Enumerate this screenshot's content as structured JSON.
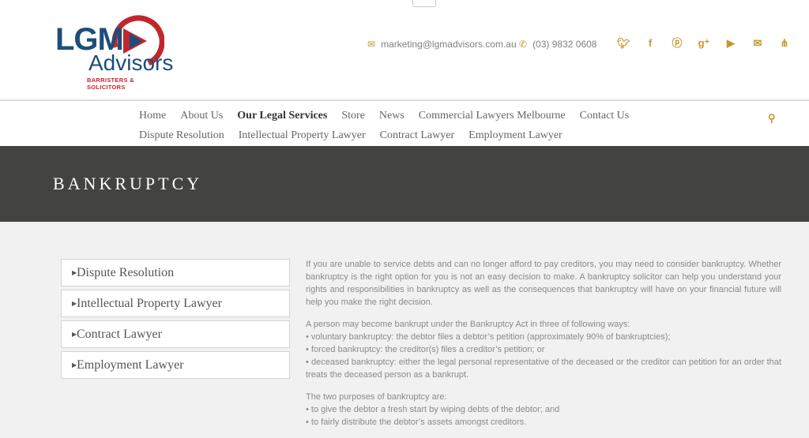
{
  "logo": {
    "line1": "LGM",
    "line2": "Advisors",
    "tagline": "BARRISTERS & SOLICITORS"
  },
  "contact": {
    "email": "marketing@lgmadvisors.com.au",
    "phone": "(03) 9832 0608",
    "email_icon": "envelope-icon",
    "phone_icon": "phone-icon"
  },
  "social": [
    "twitter-icon",
    "facebook-icon",
    "pinterest-icon",
    "google-plus-icon",
    "youtube-icon",
    "mail-icon",
    "sitemap-icon"
  ],
  "nav": {
    "row1": [
      "Home",
      "About Us",
      "Our Legal Services",
      "Store",
      "News",
      "Commercial Lawyers Melbourne",
      "Contact Us"
    ],
    "row2": [
      "Dispute Resolution",
      "Intellectual Property Lawyer",
      "Contract Lawyer",
      "Employment Lawyer"
    ],
    "active": "Our Legal Services"
  },
  "banner": {
    "title": "BANKRUPTCY"
  },
  "sidebar": {
    "items": [
      "Dispute Resolution",
      "Intellectual Property Lawyer",
      "Contract Lawyer",
      "Employment Lawyer"
    ]
  },
  "content": {
    "p1": "If you are unable to service debts and can no longer afford to pay creditors, you may need to consider bankruptcy. Whether bankruptcy is the right option for you is not an easy decision to make. A bankruptcy solicitor can help you understand your rights and responsibilities in bankruptcy as well as the consequences that bankruptcy will have on your financial future will help you make the right decision.",
    "p2_intro": "A person may become bankrupt under the Bankruptcy Act in three of following ways:",
    "p2_b1": "• voluntary bankruptcy: the debtor files a debtor’s petition (approximately 90% of bankruptcies);",
    "p2_b2": "• forced bankruptcy: the creditor(s) files a creditor’s petition; or",
    "p2_b3": "• deceased bankruptcy: either the legal personal representative of the deceased or the creditor can petition for an order that treats the deceased person as a bankrupt.",
    "p3_intro": "The two purposes of bankruptcy are:",
    "p3_b1": "• to give the debtor a fresh start by wiping debts of the debtor; and",
    "p3_b2": "• to fairly distribute the debtor’s assets amongst creditors."
  },
  "colors": {
    "accent": "#c5962b",
    "banner": "#43443f",
    "brand_blue": "#1d4e7a",
    "brand_red": "#c0272d"
  }
}
